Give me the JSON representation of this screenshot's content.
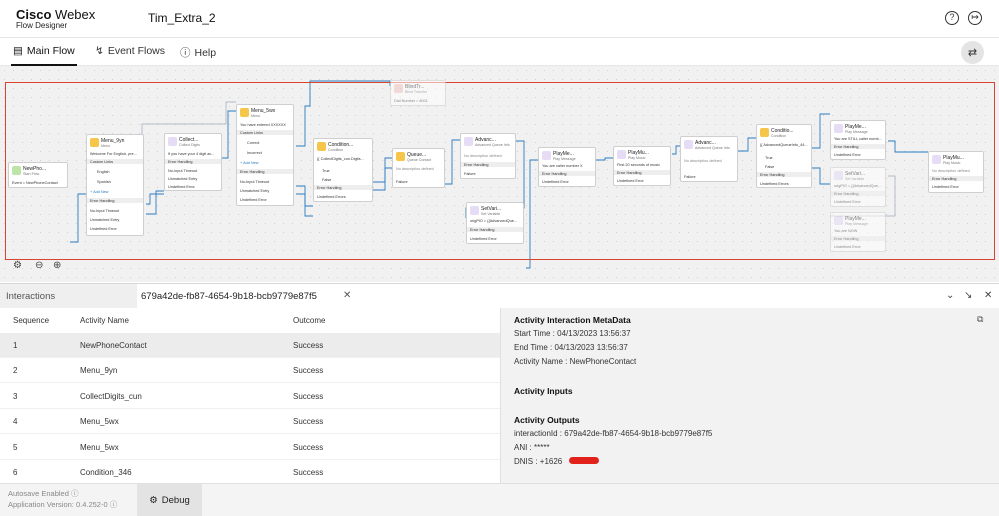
{
  "brand": {
    "name_bold": "Cisco",
    "name_light": "Webex",
    "subtitle": "Flow Designer"
  },
  "flow_name": "Tim_Extra_2",
  "header_icons": [
    "help-circle-icon",
    "logout-icon"
  ],
  "tabs": [
    {
      "label": "Main Flow",
      "icon": "flow-icon",
      "active": true
    },
    {
      "label": "Event Flows",
      "icon": "lightning-icon",
      "active": false
    },
    {
      "label": "Help",
      "icon": "help-icon",
      "active": false
    }
  ],
  "canvas": {
    "nodes": {
      "start": {
        "title": "NewPho...",
        "sub": "Start Flow",
        "l1": "Event = NewPhoneContact"
      },
      "menu1": {
        "title": "Menu_9yn",
        "sub": "Menu",
        "l1": "Welcome  For English, pre...",
        "l2": "Custom Links",
        "l3": "English",
        "l4": "Spanish",
        "l5": "+ Add New",
        "l6": "Error Handling",
        "l7": "No-Input Timeout",
        "l8": "Unmatched Entry",
        "l9": "Undefined Error"
      },
      "collect": {
        "title": "Collect...",
        "sub": "Collect Digits",
        "l1": "If you have your 4 digit ac...",
        "l2": "Error Handling",
        "l3": "No-Input Timeout",
        "l4": "Unmatched Entry",
        "l5": "Undefined Error"
      },
      "menu2": {
        "title": "Menu_5wx",
        "sub": "Menu",
        "l1": "You have entered XXXXXX",
        "l2": "Custom Links",
        "l3": "Correct",
        "l4": "Incorrect",
        "l5": "+ Add New",
        "l6": "Error Handling",
        "l7": "No-Input Timeout",
        "l8": "Unmatched Entry",
        "l9": "Undefined Error"
      },
      "blind": {
        "title": "BlindTr...",
        "sub": "Blind Transfer",
        "l1": "Dial Number = 8001"
      },
      "cond1": {
        "title": "Condition...",
        "sub": "Condition",
        "l1": "{{ CollectDigits_cun.Digits...",
        "l2": "True",
        "l3": "False",
        "l4": "Error Handling",
        "l5": "Undefined Errors"
      },
      "queue": {
        "title": "Queue...",
        "sub": "Queue Contact",
        "l1": "No description defined",
        "l2": "Failure"
      },
      "adv1": {
        "title": "Advanc...",
        "sub": "Advanced Queue Info",
        "l1": "No description defined",
        "l2": "Error Handling",
        "l3": "Failure"
      },
      "setvar1": {
        "title": "SetVari...",
        "sub": "Set Variable",
        "l1": "origPIO = {{AdvancedQue...",
        "l2": "Error Handling",
        "l3": "Undefined Error"
      },
      "play1": {
        "title": "PlayMe...",
        "sub": "Play Message",
        "l1": "You are caller number X",
        "l2": "Error Handling",
        "l3": "Undefined Error"
      },
      "music1": {
        "title": "PlayMu...",
        "sub": "Play Music",
        "l1": "First 20 seconds of music",
        "l2": "Error Handling",
        "l3": "Undefined Error"
      },
      "adv2": {
        "title": "Advanc...",
        "sub": "Advanced Queue Info",
        "l1": "No description defined",
        "l2": "Failure"
      },
      "cond2": {
        "title": "Conditio...",
        "sub": "Condition",
        "l1": "{{ AdvancedQueueInfo_44...",
        "l2": "True",
        "l3": "False",
        "l4": "Error Handling",
        "l5": "Undefined Errors"
      },
      "play2": {
        "title": "PlayMe...",
        "sub": "Play Message",
        "l1": "You are STILL caller numb...",
        "l2": "Error Handling",
        "l3": "Undefined Error"
      },
      "setvar2": {
        "title": "SetVari...",
        "sub": "Set Variable",
        "l1": "origPIO = {{AdvancedQue...",
        "l2": "Error Handling",
        "l3": "Undefined Error"
      },
      "play3": {
        "title": "PlayMe...",
        "sub": "Play Message",
        "l1": "You are NOW",
        "l2": "Error Handling",
        "l3": "Undefined Error"
      },
      "music2": {
        "title": "PlayMu...",
        "sub": "Play Music",
        "l1": "No description defined",
        "l2": "Error Handling",
        "l3": "Undefined Error"
      }
    },
    "tools": [
      "settings-icon",
      "zoom-out-icon",
      "zoom-in-icon"
    ]
  },
  "panel": {
    "interactions_label": "Interactions",
    "interaction_id": "679a42de-fb87-4654-9b18-bcb9779e87f5",
    "columns": {
      "sequence": "Sequence",
      "activity": "Activity Name",
      "outcome": "Outcome"
    },
    "rows": [
      {
        "seq": "1",
        "name": "NewPhoneContact",
        "outcome": "Success"
      },
      {
        "seq": "2",
        "name": "Menu_9yn",
        "outcome": "Success"
      },
      {
        "seq": "3",
        "name": "CollectDigits_cun",
        "outcome": "Success"
      },
      {
        "seq": "4",
        "name": "Menu_5wx",
        "outcome": "Success"
      },
      {
        "seq": "5",
        "name": "Menu_5wx",
        "outcome": "Success"
      },
      {
        "seq": "6",
        "name": "Condition_346",
        "outcome": "Success"
      }
    ],
    "details": {
      "metadata_title": "Activity Interaction MetaData",
      "start_time": "Start Time : 04/13/2023 13:56:37",
      "end_time": "End Time : 04/13/2023 13:56:37",
      "activity_name": "Activity Name : NewPhoneContact",
      "inputs_title": "Activity Inputs",
      "outputs_title": "Activity Outputs",
      "interaction_id": "interactionId : 679a42de-fb87-4654-9b18-bcb9779e87f5",
      "ani": "ANI : *****",
      "dnis": "DNIS : +1626"
    }
  },
  "footer": {
    "autosave": "Autosave Enabled",
    "app_version": "Application Version: 0.4.252-0",
    "debug_label": "Debug"
  },
  "colors": {
    "highlight_frame": "#d9442f",
    "redaction": "#e3211b",
    "connector": "#2b7bbf"
  }
}
